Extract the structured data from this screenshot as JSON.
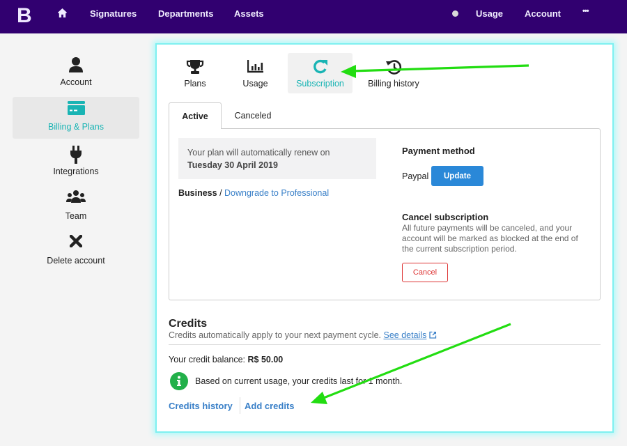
{
  "topnav": {
    "logo": "B",
    "items": [
      {
        "label": "Signatures"
      },
      {
        "label": "Departments"
      },
      {
        "label": "Assets"
      }
    ],
    "right_items": [
      {
        "label": "Usage"
      },
      {
        "label": "Account"
      },
      {
        "label": "•••"
      }
    ],
    "home_icon": "home-icon",
    "status_dot_icon": "status-dot-icon"
  },
  "sidebar": {
    "items": [
      {
        "label": "Account",
        "icon": "user-icon",
        "active": false
      },
      {
        "label": "Billing & Plans",
        "icon": "credit-card-icon",
        "active": true
      },
      {
        "label": "Integrations",
        "icon": "plug-icon",
        "active": false
      },
      {
        "label": "Team",
        "icon": "users-icon",
        "active": false
      },
      {
        "label": "Delete account",
        "icon": "close-icon",
        "active": false
      }
    ]
  },
  "subtabs": [
    {
      "label": "Plans",
      "icon": "trophy-icon",
      "active": false
    },
    {
      "label": "Usage",
      "icon": "bar-chart-icon",
      "active": false
    },
    {
      "label": "Subscription",
      "icon": "refresh-icon",
      "active": true
    },
    {
      "label": "Billing history",
      "icon": "history-icon",
      "active": false
    }
  ],
  "tabs": [
    {
      "label": "Active",
      "active": true
    },
    {
      "label": "Canceled",
      "active": false
    }
  ],
  "subscription": {
    "renew_text": "Your plan will automatically renew on",
    "renew_date": "Tuesday 30 April 2019",
    "plan_name": "Business",
    "plan_separator": " / ",
    "downgrade_link": "Downgrade to Professional",
    "payment_title": "Payment method",
    "payment_method": "Paypal",
    "update_button": "Update",
    "cancel_title": "Cancel subscription",
    "cancel_desc": "All future payments will be canceled, and your account will be marked as blocked at the end of the current subscription period.",
    "cancel_button": "Cancel"
  },
  "credits": {
    "title": "Credits",
    "subtitle": "Credits automatically apply to your next payment cycle.",
    "see_details": "See details",
    "balance_label": "Your credit balance: ",
    "balance_value": "R$ 50.00",
    "info_text": "Based on current usage, your credits last for 1 month.",
    "history_link": "Credits history",
    "add_link": "Add credits"
  },
  "colors": {
    "nav_bg": "#310070",
    "accent": "#19b4b4",
    "link": "#3a80c8",
    "primary_button": "#2a88d8",
    "danger": "#dd3333",
    "info": "#22b04a",
    "annotation_arrow": "#22dd11",
    "panel_glow": "#7ff0f0"
  }
}
